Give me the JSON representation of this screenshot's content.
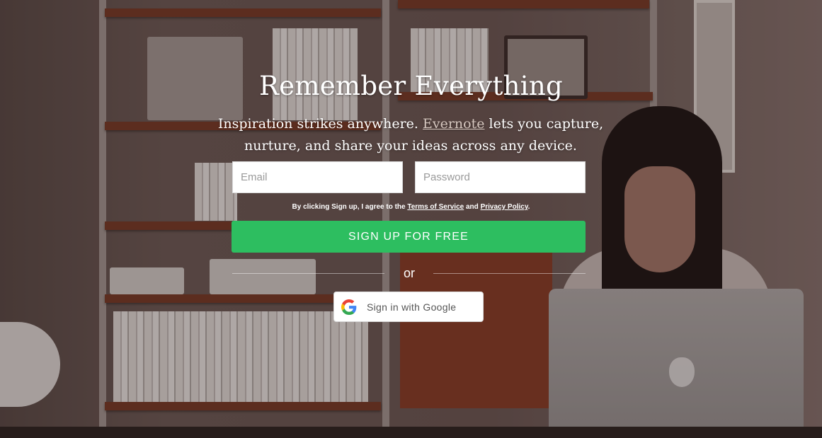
{
  "hero": {
    "title": "Remember Everything",
    "subtitle_before": "Inspiration strikes anywhere. ",
    "subtitle_brand": "Evernote",
    "subtitle_after": " lets you capture, nurture, and share your ideas across any device."
  },
  "form": {
    "email_placeholder": "Email",
    "password_placeholder": "Password",
    "terms_prefix": "By clicking Sign up, I agree to the ",
    "terms_of_service": "Terms of Service",
    "terms_and": " and ",
    "privacy_policy": "Privacy Policy",
    "terms_suffix": ".",
    "signup_label": "SIGN UP FOR FREE",
    "or_label": "or",
    "google_label": "Sign in with Google"
  },
  "colors": {
    "signup_green": "#2dbe60",
    "google_blue": "#4285F4",
    "google_red": "#EA4335",
    "google_yellow": "#FBBC05",
    "google_green": "#34A853"
  },
  "icons": {
    "google": "google-g-icon"
  }
}
